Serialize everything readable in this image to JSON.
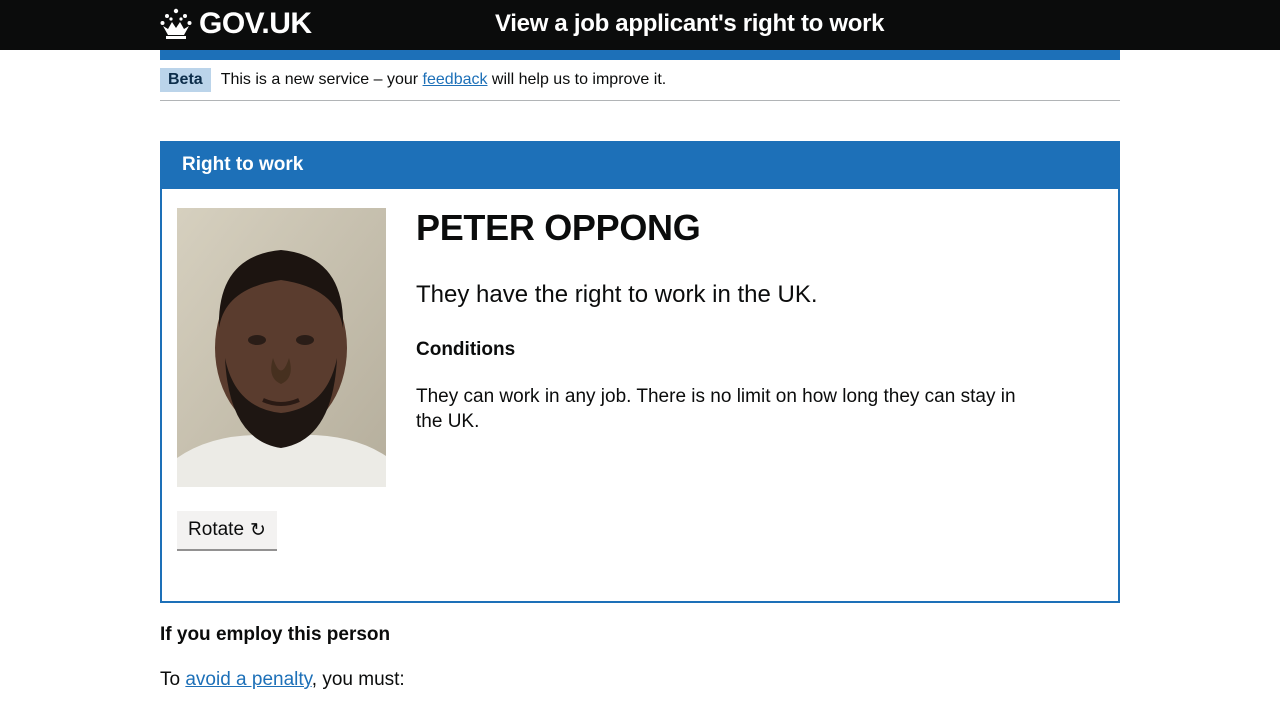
{
  "header": {
    "logo_text": "GOV.UK",
    "service_name": "View a job applicant's right to work"
  },
  "phase_banner": {
    "tag": "Beta",
    "text_before": "This is a new service – your ",
    "link_text": "feedback",
    "text_after": " will help us to improve it."
  },
  "panel": {
    "title": "Right to work",
    "person_name": "PETER OPPONG",
    "status": "They have the right to work in the UK.",
    "conditions_heading": "Conditions",
    "conditions_text": "They can work in any job. There is no limit on how long they can stay in the UK.",
    "rotate_label": "Rotate",
    "rotate_icon": "↻"
  },
  "employ": {
    "heading": "If you employ this person",
    "penalty_before": "To ",
    "penalty_link": "avoid a penalty",
    "penalty_after": ", you must:"
  },
  "colors": {
    "header_bg": "#0b0c0c",
    "brand_blue": "#1d70b8",
    "link": "#1d70b8",
    "tag_bg": "#bbd4ea"
  }
}
